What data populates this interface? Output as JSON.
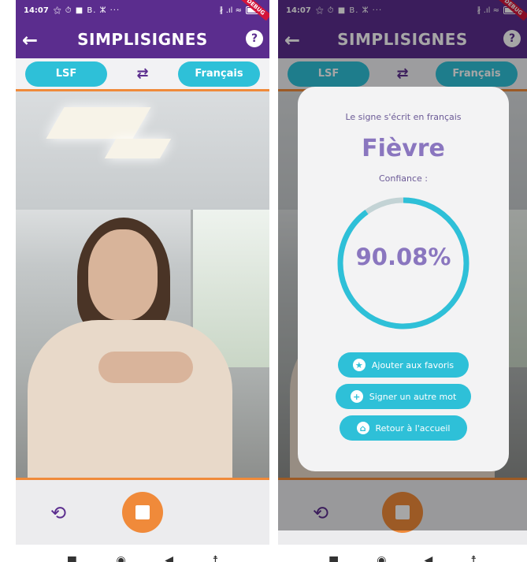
{
  "status": {
    "time": "14:07",
    "icons": "⚝ ⏱ ■ B. ⵣ ···",
    "right_icons": "∦ .ıl ≈",
    "debug": "DEBUG"
  },
  "app": {
    "title": "SIMPLISIGNES",
    "back": "←",
    "help": "?"
  },
  "languages": {
    "source": "LSF",
    "target": "Français",
    "swap": "⇄"
  },
  "controls": {
    "rotate": "⟲"
  },
  "nav": {
    "recents": "■",
    "home": "◉",
    "back": "◀",
    "accessibility": "☨"
  },
  "result": {
    "caption": "Le signe s'écrit en français",
    "word": "Fièvre",
    "confidence_label": "Confiance :",
    "confidence_value": "90.08%",
    "confidence_fraction": 0.9008,
    "buttons": {
      "favorite": "Ajouter aux favoris",
      "sign_again": "Signer un autre mot",
      "home": "Retour à l'accueil"
    }
  },
  "colors": {
    "purple": "#5b2d8e",
    "cyan": "#2ec0d8",
    "orange": "#f08a3a",
    "ring_track": "#c3d3d5"
  }
}
